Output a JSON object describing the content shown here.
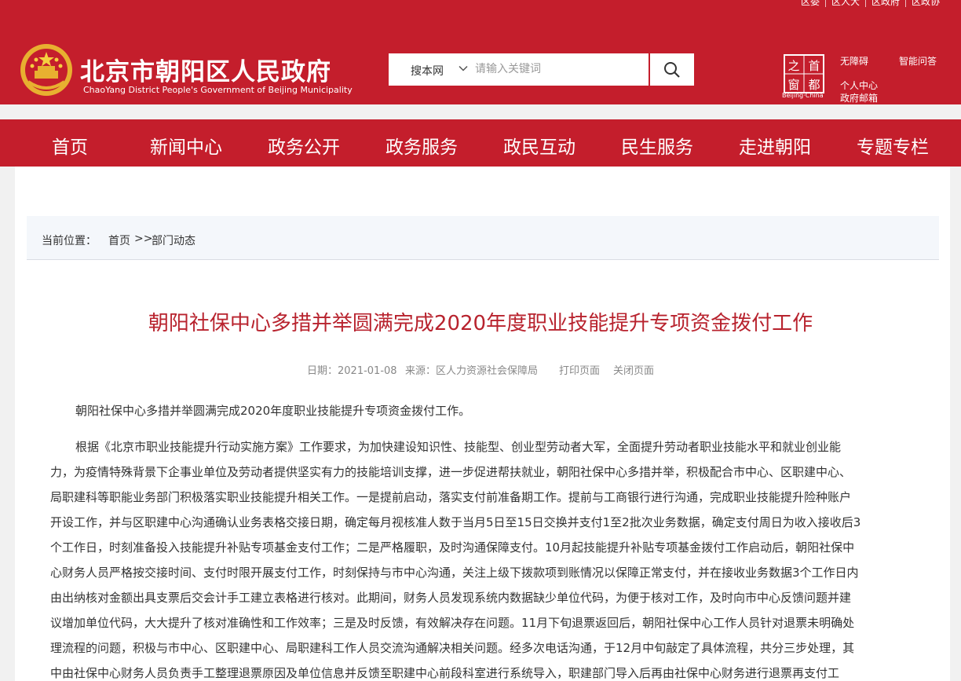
{
  "header": {
    "top_links": [
      "区委",
      "区人大",
      "区政府",
      "区政协"
    ],
    "title": "北京市朝阳区人民政府",
    "subtitle": "ChaoYang District People's Government of Beijing Municipality",
    "search": {
      "scope": "搜本网",
      "placeholder": "请输入关键词"
    },
    "capital_logo_text": "Beijing·China",
    "capital_logo_chars": [
      "之",
      "首",
      "窗",
      "都"
    ],
    "util_links": {
      "accessibility": "无障碍",
      "smart_qa": "智能问答",
      "personal_center": "个人中心",
      "gov_mail": "政府邮箱"
    }
  },
  "nav": {
    "items": [
      "首页",
      "新闻中心",
      "政务公开",
      "政务服务",
      "政民互动",
      "民生服务",
      "走进朝阳",
      "专题专栏"
    ]
  },
  "breadcrumb": {
    "label": "当前位置：",
    "home": "首页",
    "sep": ">>",
    "current": "部门动态"
  },
  "article": {
    "title": "朝阳社保中心多措并举圆满完成2020年度职业技能提升专项资金拨付工作",
    "date": "日期：2021-01-08",
    "source": "来源：区人力资源社会保障局",
    "print": "打印页面",
    "close": "关闭页面",
    "lead": "朝阳社保中心多措并举圆满完成2020年度职业技能提升专项资金拨付工作。",
    "body_lines": [
      "根据《北京市职业技能提升行动实施方案》工作要求，为加快建设知识性、技能型、创业型劳动者大军，全面提升劳动者职业技能水平和就业创业能",
      "力，为疫情特殊背景下企事业单位及劳动者提供坚实有力的技能培训支撑，进一步促进帮扶就业，朝阳社保中心多措并举，积极配合市中心、区职建中心、",
      "局职建科等职能业务部门积极落实职业技能提升相关工作。一是提前启动，落实支付前准备期工作。提前与工商银行进行沟通，完成职业技能提升险种账户",
      "开设工作，并与区职建中心沟通确认业务表格交接日期，确定每月视核准人数于当月5日至15日交换并支付1至2批次业务数据，确定支付周日为收入接收后3",
      "个工作日，时刻准备投入技能提升补贴专项基金支付工作；二是严格履职，及时沟通保障支付。10月起技能提升补贴专项基金拨付工作启动后，朝阳社保中",
      "心财务人员严格按交接时间、支付时限开展支付工作，时刻保持与市中心沟通，关注上级下拨款项到账情况以保障正常支付，并在接收业务数据3个工作日内",
      "由出纳核对金额出具支票后交会计手工建立表格进行核对。此期间，财务人员发现系统内数据缺少单位代码，为便于核对工作，及时向市中心反馈问题并建",
      "议增加单位代码，大大提升了核对准确性和工作效率；三是及时反馈，有效解决存在问题。11月下旬退票返回后，朝阳社保中心工作人员针对退票未明确处",
      "理流程的问题，积极与市中心、区职建中心、局职建科工作人员交流沟通解决相关问题。经多次电话沟通，于12月中旬敲定了具体流程，共分三步处理，其",
      "中由社保中心财务人员负责手工整理退票原因及单位信息并反馈至职建中心前段科室进行系统导入，职建部门导入后再由社保中心财务进行退票再支付工"
    ]
  },
  "colors": {
    "brand_red": "#c41e2c",
    "title_red": "#b8232e",
    "breadcrumb_bg": "#f4f7fb"
  }
}
